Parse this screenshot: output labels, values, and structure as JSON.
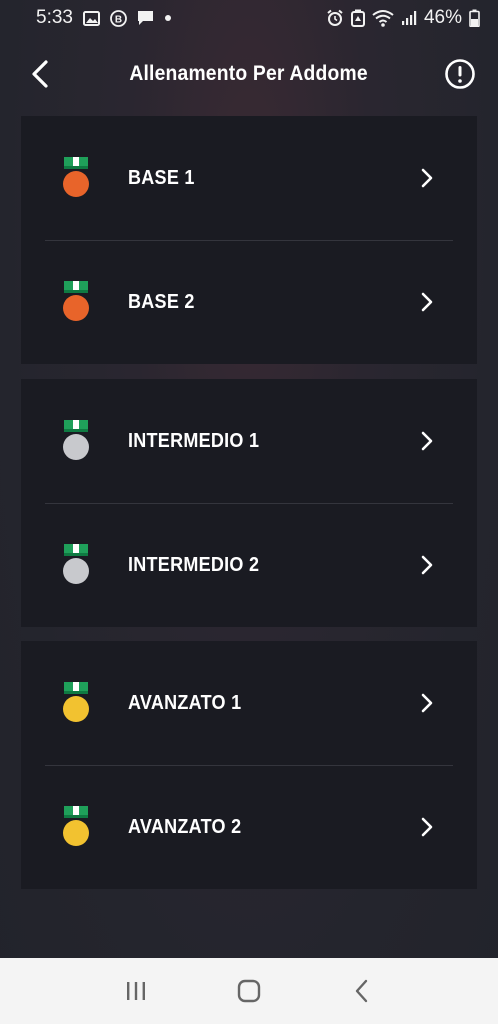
{
  "status_bar": {
    "time": "5:33",
    "battery": "46%"
  },
  "header": {
    "title": "Allenamento Per Addome"
  },
  "levels": [
    {
      "label": "BASE 1",
      "medal": "bronze-medal-icon",
      "medal_color": "#e8642a",
      "ribbon_color": "#1fa05a"
    },
    {
      "label": "BASE 2",
      "medal": "bronze-medal-icon",
      "medal_color": "#e8642a",
      "ribbon_color": "#1fa05a"
    },
    {
      "label": "INTERMEDIO 1",
      "medal": "silver-medal-icon",
      "medal_color": "#c8c9cd",
      "ribbon_color": "#1fa05a"
    },
    {
      "label": "INTERMEDIO 2",
      "medal": "silver-medal-icon",
      "medal_color": "#c8c9cd",
      "ribbon_color": "#1fa05a"
    },
    {
      "label": "AVANZATO 1",
      "medal": "gold-medal-icon",
      "medal_color": "#f2c230",
      "ribbon_color": "#1fa05a"
    },
    {
      "label": "AVANZATO 2",
      "medal": "gold-medal-icon",
      "medal_color": "#f2c230",
      "ribbon_color": "#1fa05a"
    }
  ],
  "colors": {
    "card_bg": "#1a1b22",
    "divider": "#34353d",
    "nav_bar_bg": "#f4f4f4"
  }
}
